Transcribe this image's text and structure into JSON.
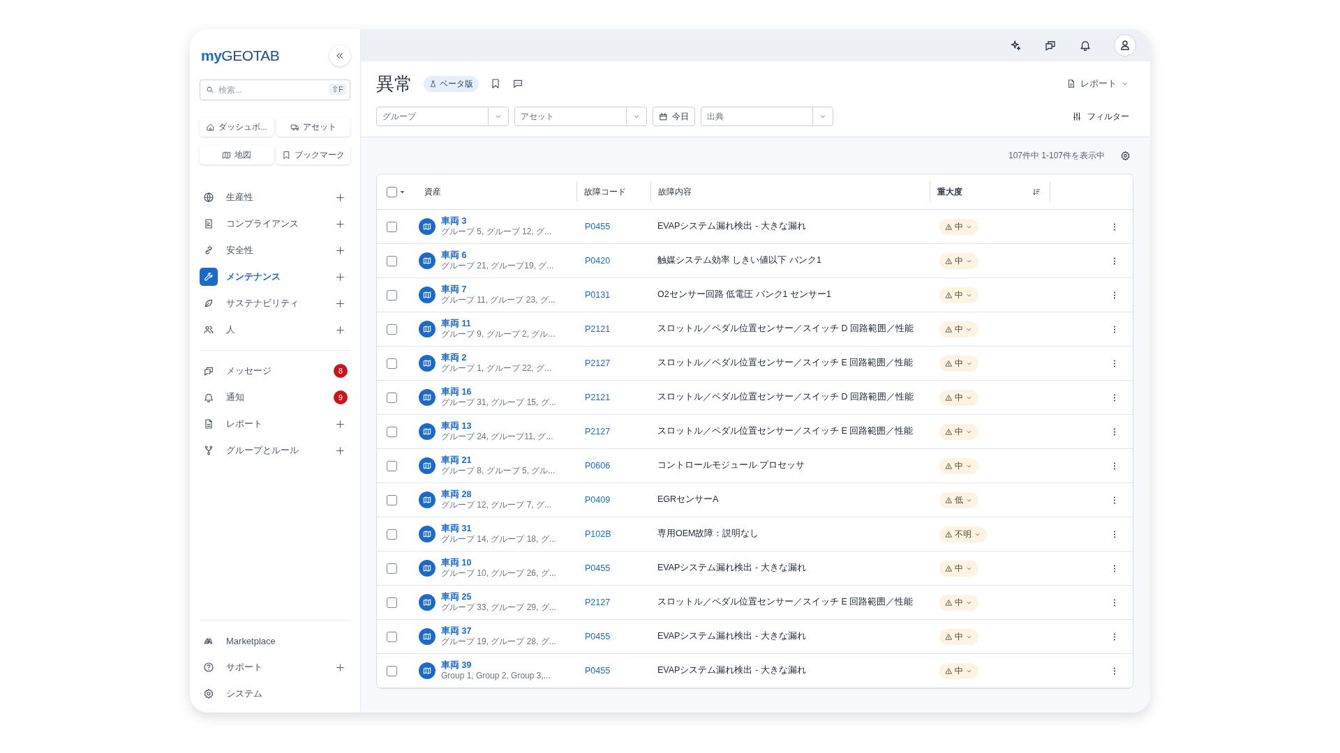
{
  "sidebar": {
    "logo": {
      "prefix": "my",
      "name": "GEOTAB"
    },
    "search": {
      "placeholder": "検索...",
      "shortcut": "⇧F"
    },
    "quick_links": [
      {
        "label": "ダッシュボ..."
      },
      {
        "label": "アセット"
      },
      {
        "label": "地図"
      },
      {
        "label": "ブックマーク"
      }
    ],
    "nav": [
      {
        "label": "生産性",
        "selected": false,
        "kind": "expand"
      },
      {
        "label": "コンプライアンス",
        "selected": false,
        "kind": "expand"
      },
      {
        "label": "安全性",
        "selected": false,
        "kind": "expand"
      },
      {
        "label": "メンテナンス",
        "selected": true,
        "kind": "expand"
      },
      {
        "label": "サステナビリティ",
        "selected": false,
        "kind": "expand"
      },
      {
        "label": "人",
        "selected": false,
        "kind": "expand"
      }
    ],
    "nav_secondary": [
      {
        "label": "メッセージ",
        "selected": false,
        "kind": "badge",
        "badge": "8"
      },
      {
        "label": "通知",
        "selected": false,
        "kind": "badge",
        "badge": "9"
      },
      {
        "label": "レポート",
        "selected": false,
        "kind": "expand"
      },
      {
        "label": "グループとルール",
        "selected": false,
        "kind": "expand"
      }
    ],
    "footer": [
      {
        "label": "Marketplace",
        "kind": "plain"
      },
      {
        "label": "サポート",
        "kind": "expand"
      },
      {
        "label": "システム",
        "kind": "plain"
      }
    ]
  },
  "page": {
    "title": "異常",
    "beta_chip": "ベータ版",
    "report_button": "レポート",
    "filters": [
      {
        "kind": "dropdown",
        "placeholder": "グループ"
      },
      {
        "kind": "dropdown",
        "placeholder": "アセット"
      },
      {
        "kind": "date",
        "label": "今日"
      },
      {
        "kind": "dropdown",
        "placeholder": "出典"
      }
    ],
    "filter_button": "フィルター",
    "count": "107件中 1-107件を表示中"
  },
  "table": {
    "select_all": {
      "checked": false
    },
    "columns": [
      "資産",
      "故障コード",
      "故障内容",
      "重大度"
    ],
    "rows": [
      {
        "checked": false,
        "asset": "車両 3",
        "groups": "グループ 5, グループ 12, グ...",
        "code": "P0455",
        "description": "EVAPシステム漏れ検出 - 大きな漏れ",
        "severity": "中"
      },
      {
        "checked": false,
        "asset": "車両 6",
        "groups": "グループ 21, グループ19, グ...",
        "code": "P0420",
        "description": "触媒システム効率 しきい値以下 バンク1",
        "severity": "中"
      },
      {
        "checked": false,
        "asset": "車両 7",
        "groups": "グループ 11, グループ 23, グ...",
        "code": "P0131",
        "description": "O2センサー回路 低電圧 バンク1 センサー1",
        "severity": "中"
      },
      {
        "checked": false,
        "asset": "車両 11",
        "groups": "グループ 9, グループ 2, グル...",
        "code": "P2121",
        "description": "スロットル／ペダル位置センサー／スイッチ D 回路範囲／性能",
        "severity": "中"
      },
      {
        "checked": false,
        "asset": "車両 2",
        "groups": "グループ 1, グループ 22, グ...",
        "code": "P2127",
        "description": "スロットル／ペダル位置センサー／スイッチ E 回路範囲／性能",
        "severity": "中"
      },
      {
        "checked": false,
        "asset": "車両 16",
        "groups": "グループ 31, グループ 15, グ...",
        "code": "P2121",
        "description": "スロットル／ペダル位置センサー／スイッチ D 回路範囲／性能",
        "severity": "中"
      },
      {
        "checked": false,
        "asset": "車両 13",
        "groups": "グループ 24, グループ11, グ...",
        "code": "P2127",
        "description": "スロットル／ペダル位置センサー／スイッチ E 回路範囲／性能",
        "severity": "中"
      },
      {
        "checked": false,
        "asset": "車両 21",
        "groups": "グループ 8, グループ 5, グル...",
        "code": "P0606",
        "description": "コントロールモジュール プロセッサ",
        "severity": "中"
      },
      {
        "checked": false,
        "asset": "車両 28",
        "groups": "グループ 12, グループ 7, グ...",
        "code": "P0409",
        "description": "EGRセンサーA",
        "severity": "低"
      },
      {
        "checked": false,
        "asset": "車両 31",
        "groups": "グループ 14, グループ 18, グ...",
        "code": "P102B",
        "description": "専用OEM故障：説明なし",
        "severity": "不明"
      },
      {
        "checked": false,
        "asset": "車両 10",
        "groups": "グループ 10, グループ 26, グ...",
        "code": "P0455",
        "description": "EVAPシステム漏れ検出 - 大きな漏れ",
        "severity": "中"
      },
      {
        "checked": false,
        "asset": "車両 25",
        "groups": "グループ 33, グループ 29, グ...",
        "code": "P2127",
        "description": "スロットル／ペダル位置センサー／スイッチ E 回路範囲／性能",
        "severity": "中"
      },
      {
        "checked": false,
        "asset": "車両 37",
        "groups": "グループ 19, グループ 28, グ...",
        "code": "P0455",
        "description": "EVAPシステム漏れ検出 - 大きな漏れ",
        "severity": "中"
      },
      {
        "checked": false,
        "asset": "車両 39",
        "groups": "Group 1, Group 2, Group 3,...",
        "code": "P0455",
        "description": "EVAPシステム漏れ検出 - 大きな漏れ",
        "severity": "中"
      }
    ]
  }
}
